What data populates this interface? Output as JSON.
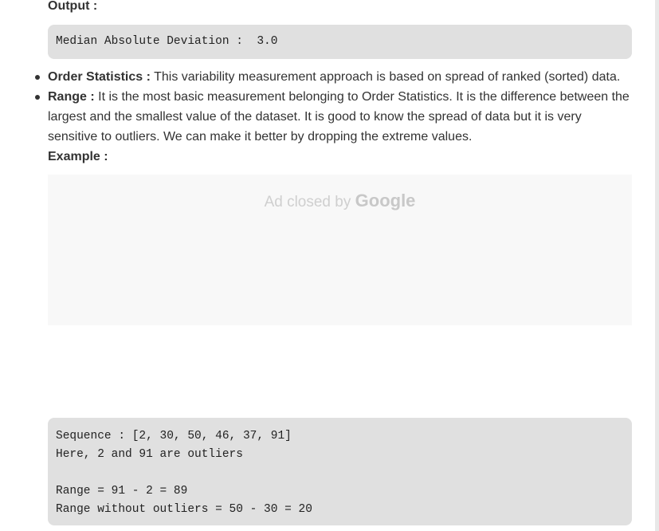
{
  "output": {
    "heading": "Output :",
    "code": "Median Absolute Deviation :  3.0"
  },
  "bullets": [
    {
      "term": "Order Statistics :",
      "text": " This variability measurement approach is based on spread of ranked (sorted) data."
    },
    {
      "term": "Range :",
      "text": " It is the most basic measurement belonging to Order Statistics. It is the difference between the largest and the smallest value of the dataset. It is good to know the spread of data but it is very sensitive to outliers. We can make it better by dropping the extreme values."
    }
  ],
  "example": {
    "heading": "Example :",
    "code_lines": [
      "Sequence : [2, 30, 50, 46, 37, 91]",
      "Here, 2 and 91 are outliers",
      "",
      "Range = 91 - 2 = 89",
      "Range without outliers = 50 - 30 = 20"
    ]
  },
  "ad": {
    "text": "Ad closed by ",
    "brand": "Google"
  }
}
